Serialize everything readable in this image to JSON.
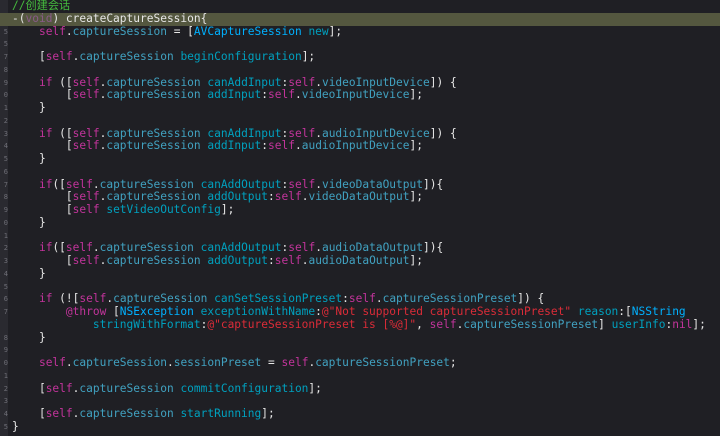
{
  "editor": {
    "lines": [
      {
        "num": "",
        "highlight": false,
        "tokens": [
          {
            "t": "//创建会话",
            "c": "comment"
          }
        ]
      },
      {
        "num": "",
        "highlight": true,
        "tokens": [
          {
            "t": "-(",
            "c": "plain"
          },
          {
            "t": "void",
            "c": "kw"
          },
          {
            "t": ") createCaptureSession{",
            "c": "plain"
          }
        ]
      },
      {
        "num": "5",
        "highlight": false,
        "tokens": [
          {
            "t": "    ",
            "c": "plain"
          },
          {
            "t": "self",
            "c": "kw"
          },
          {
            "t": ".",
            "c": "plain"
          },
          {
            "t": "captureSession",
            "c": "prop"
          },
          {
            "t": " = [",
            "c": "plain"
          },
          {
            "t": "AVCaptureSession",
            "c": "cls"
          },
          {
            "t": " ",
            "c": "plain"
          },
          {
            "t": "new",
            "c": "mth"
          },
          {
            "t": "];",
            "c": "plain"
          }
        ]
      },
      {
        "num": "5",
        "highlight": false,
        "tokens": []
      },
      {
        "num": "7",
        "highlight": false,
        "tokens": [
          {
            "t": "    [",
            "c": "plain"
          },
          {
            "t": "self",
            "c": "kw"
          },
          {
            "t": ".",
            "c": "plain"
          },
          {
            "t": "captureSession",
            "c": "prop"
          },
          {
            "t": " ",
            "c": "plain"
          },
          {
            "t": "beginConfiguration",
            "c": "mth"
          },
          {
            "t": "];",
            "c": "plain"
          }
        ]
      },
      {
        "num": "8",
        "highlight": false,
        "tokens": []
      },
      {
        "num": "9",
        "highlight": false,
        "tokens": [
          {
            "t": "    ",
            "c": "plain"
          },
          {
            "t": "if",
            "c": "kw"
          },
          {
            "t": " ([",
            "c": "plain"
          },
          {
            "t": "self",
            "c": "kw"
          },
          {
            "t": ".",
            "c": "plain"
          },
          {
            "t": "captureSession",
            "c": "prop"
          },
          {
            "t": " ",
            "c": "plain"
          },
          {
            "t": "canAddInput",
            "c": "mth"
          },
          {
            "t": ":",
            "c": "plain"
          },
          {
            "t": "self",
            "c": "kw"
          },
          {
            "t": ".",
            "c": "plain"
          },
          {
            "t": "videoInputDevice",
            "c": "prop"
          },
          {
            "t": "]) {",
            "c": "plain"
          }
        ]
      },
      {
        "num": "0",
        "highlight": false,
        "tokens": [
          {
            "t": "        [",
            "c": "plain"
          },
          {
            "t": "self",
            "c": "kw"
          },
          {
            "t": ".",
            "c": "plain"
          },
          {
            "t": "captureSession",
            "c": "prop"
          },
          {
            "t": " ",
            "c": "plain"
          },
          {
            "t": "addInput",
            "c": "mth"
          },
          {
            "t": ":",
            "c": "plain"
          },
          {
            "t": "self",
            "c": "kw"
          },
          {
            "t": ".",
            "c": "plain"
          },
          {
            "t": "videoInputDevice",
            "c": "prop"
          },
          {
            "t": "];",
            "c": "plain"
          }
        ]
      },
      {
        "num": "1",
        "highlight": false,
        "tokens": [
          {
            "t": "    }",
            "c": "plain"
          }
        ]
      },
      {
        "num": "2",
        "highlight": false,
        "tokens": []
      },
      {
        "num": "3",
        "highlight": false,
        "tokens": [
          {
            "t": "    ",
            "c": "plain"
          },
          {
            "t": "if",
            "c": "kw"
          },
          {
            "t": " ([",
            "c": "plain"
          },
          {
            "t": "self",
            "c": "kw"
          },
          {
            "t": ".",
            "c": "plain"
          },
          {
            "t": "captureSession",
            "c": "prop"
          },
          {
            "t": " ",
            "c": "plain"
          },
          {
            "t": "canAddInput",
            "c": "mth"
          },
          {
            "t": ":",
            "c": "plain"
          },
          {
            "t": "self",
            "c": "kw"
          },
          {
            "t": ".",
            "c": "plain"
          },
          {
            "t": "audioInputDevice",
            "c": "prop"
          },
          {
            "t": "]) {",
            "c": "plain"
          }
        ]
      },
      {
        "num": "4",
        "highlight": false,
        "tokens": [
          {
            "t": "        [",
            "c": "plain"
          },
          {
            "t": "self",
            "c": "kw"
          },
          {
            "t": ".",
            "c": "plain"
          },
          {
            "t": "captureSession",
            "c": "prop"
          },
          {
            "t": " ",
            "c": "plain"
          },
          {
            "t": "addInput",
            "c": "mth"
          },
          {
            "t": ":",
            "c": "plain"
          },
          {
            "t": "self",
            "c": "kw"
          },
          {
            "t": ".",
            "c": "plain"
          },
          {
            "t": "audioInputDevice",
            "c": "prop"
          },
          {
            "t": "];",
            "c": "plain"
          }
        ]
      },
      {
        "num": "5",
        "highlight": false,
        "tokens": [
          {
            "t": "    }",
            "c": "plain"
          }
        ]
      },
      {
        "num": "6",
        "highlight": false,
        "tokens": []
      },
      {
        "num": "7",
        "highlight": false,
        "tokens": [
          {
            "t": "    ",
            "c": "plain"
          },
          {
            "t": "if",
            "c": "kw"
          },
          {
            "t": "([",
            "c": "plain"
          },
          {
            "t": "self",
            "c": "kw"
          },
          {
            "t": ".",
            "c": "plain"
          },
          {
            "t": "captureSession",
            "c": "prop"
          },
          {
            "t": " ",
            "c": "plain"
          },
          {
            "t": "canAddOutput",
            "c": "mth"
          },
          {
            "t": ":",
            "c": "plain"
          },
          {
            "t": "self",
            "c": "kw"
          },
          {
            "t": ".",
            "c": "plain"
          },
          {
            "t": "videoDataOutput",
            "c": "prop"
          },
          {
            "t": "]){",
            "c": "plain"
          }
        ]
      },
      {
        "num": "8",
        "highlight": false,
        "tokens": [
          {
            "t": "        [",
            "c": "plain"
          },
          {
            "t": "self",
            "c": "kw"
          },
          {
            "t": ".",
            "c": "plain"
          },
          {
            "t": "captureSession",
            "c": "prop"
          },
          {
            "t": " ",
            "c": "plain"
          },
          {
            "t": "addOutput",
            "c": "mth"
          },
          {
            "t": ":",
            "c": "plain"
          },
          {
            "t": "self",
            "c": "kw"
          },
          {
            "t": ".",
            "c": "plain"
          },
          {
            "t": "videoDataOutput",
            "c": "prop"
          },
          {
            "t": "];",
            "c": "plain"
          }
        ]
      },
      {
        "num": "9",
        "highlight": false,
        "tokens": [
          {
            "t": "        [",
            "c": "plain"
          },
          {
            "t": "self",
            "c": "kw"
          },
          {
            "t": " ",
            "c": "plain"
          },
          {
            "t": "setVideoOutConfig",
            "c": "mth"
          },
          {
            "t": "];",
            "c": "plain"
          }
        ]
      },
      {
        "num": "0",
        "highlight": false,
        "tokens": [
          {
            "t": "    }",
            "c": "plain"
          }
        ]
      },
      {
        "num": "1",
        "highlight": false,
        "tokens": []
      },
      {
        "num": "2",
        "highlight": false,
        "tokens": [
          {
            "t": "    ",
            "c": "plain"
          },
          {
            "t": "if",
            "c": "kw"
          },
          {
            "t": "([",
            "c": "plain"
          },
          {
            "t": "self",
            "c": "kw"
          },
          {
            "t": ".",
            "c": "plain"
          },
          {
            "t": "captureSession",
            "c": "prop"
          },
          {
            "t": " ",
            "c": "plain"
          },
          {
            "t": "canAddOutput",
            "c": "mth"
          },
          {
            "t": ":",
            "c": "plain"
          },
          {
            "t": "self",
            "c": "kw"
          },
          {
            "t": ".",
            "c": "plain"
          },
          {
            "t": "audioDataOutput",
            "c": "prop"
          },
          {
            "t": "]){",
            "c": "plain"
          }
        ]
      },
      {
        "num": "3",
        "highlight": false,
        "tokens": [
          {
            "t": "        [",
            "c": "plain"
          },
          {
            "t": "self",
            "c": "kw"
          },
          {
            "t": ".",
            "c": "plain"
          },
          {
            "t": "captureSession",
            "c": "prop"
          },
          {
            "t": " ",
            "c": "plain"
          },
          {
            "t": "addOutput",
            "c": "mth"
          },
          {
            "t": ":",
            "c": "plain"
          },
          {
            "t": "self",
            "c": "kw"
          },
          {
            "t": ".",
            "c": "plain"
          },
          {
            "t": "audioDataOutput",
            "c": "prop"
          },
          {
            "t": "];",
            "c": "plain"
          }
        ]
      },
      {
        "num": "4",
        "highlight": false,
        "tokens": [
          {
            "t": "    }",
            "c": "plain"
          }
        ]
      },
      {
        "num": "5",
        "highlight": false,
        "tokens": []
      },
      {
        "num": "6",
        "highlight": false,
        "tokens": [
          {
            "t": "    ",
            "c": "plain"
          },
          {
            "t": "if",
            "c": "kw"
          },
          {
            "t": " (![",
            "c": "plain"
          },
          {
            "t": "self",
            "c": "kw"
          },
          {
            "t": ".",
            "c": "plain"
          },
          {
            "t": "captureSession",
            "c": "prop"
          },
          {
            "t": " ",
            "c": "plain"
          },
          {
            "t": "canSetSessionPreset",
            "c": "mth"
          },
          {
            "t": ":",
            "c": "plain"
          },
          {
            "t": "self",
            "c": "kw"
          },
          {
            "t": ".",
            "c": "plain"
          },
          {
            "t": "captureSessionPreset",
            "c": "prop"
          },
          {
            "t": "]) {",
            "c": "plain"
          }
        ]
      },
      {
        "num": "7",
        "highlight": false,
        "tokens": [
          {
            "t": "        ",
            "c": "plain"
          },
          {
            "t": "@throw",
            "c": "kw"
          },
          {
            "t": " [",
            "c": "plain"
          },
          {
            "t": "NSException",
            "c": "cls"
          },
          {
            "t": " ",
            "c": "plain"
          },
          {
            "t": "exceptionWithName",
            "c": "mth"
          },
          {
            "t": ":",
            "c": "plain"
          },
          {
            "t": "@\"Not supported captureSessionPreset\"",
            "c": "str"
          },
          {
            "t": " ",
            "c": "plain"
          },
          {
            "t": "reason",
            "c": "mth"
          },
          {
            "t": ":[",
            "c": "plain"
          },
          {
            "t": "NSString",
            "c": "cls"
          }
        ]
      },
      {
        "num": "",
        "highlight": false,
        "tokens": [
          {
            "t": "            ",
            "c": "plain"
          },
          {
            "t": "stringWithFormat",
            "c": "mth"
          },
          {
            "t": ":",
            "c": "plain"
          },
          {
            "t": "@\"captureSessionPreset is [%@]\"",
            "c": "str"
          },
          {
            "t": ", ",
            "c": "plain"
          },
          {
            "t": "self",
            "c": "kw"
          },
          {
            "t": ".",
            "c": "plain"
          },
          {
            "t": "captureSessionPreset",
            "c": "prop"
          },
          {
            "t": "] ",
            "c": "plain"
          },
          {
            "t": "userInfo",
            "c": "mth"
          },
          {
            "t": ":",
            "c": "plain"
          },
          {
            "t": "nil",
            "c": "kw"
          },
          {
            "t": "];",
            "c": "plain"
          }
        ]
      },
      {
        "num": "8",
        "highlight": false,
        "tokens": [
          {
            "t": "    }",
            "c": "plain"
          }
        ]
      },
      {
        "num": "9",
        "highlight": false,
        "tokens": []
      },
      {
        "num": "0",
        "highlight": false,
        "tokens": [
          {
            "t": "    ",
            "c": "plain"
          },
          {
            "t": "self",
            "c": "kw"
          },
          {
            "t": ".",
            "c": "plain"
          },
          {
            "t": "captureSession",
            "c": "prop"
          },
          {
            "t": ".",
            "c": "plain"
          },
          {
            "t": "sessionPreset",
            "c": "prop"
          },
          {
            "t": " = ",
            "c": "plain"
          },
          {
            "t": "self",
            "c": "kw"
          },
          {
            "t": ".",
            "c": "plain"
          },
          {
            "t": "captureSessionPreset",
            "c": "prop"
          },
          {
            "t": ";",
            "c": "plain"
          }
        ]
      },
      {
        "num": "1",
        "highlight": false,
        "tokens": []
      },
      {
        "num": "2",
        "highlight": false,
        "tokens": [
          {
            "t": "    [",
            "c": "plain"
          },
          {
            "t": "self",
            "c": "kw"
          },
          {
            "t": ".",
            "c": "plain"
          },
          {
            "t": "captureSession",
            "c": "prop"
          },
          {
            "t": " ",
            "c": "plain"
          },
          {
            "t": "commitConfiguration",
            "c": "mth"
          },
          {
            "t": "];",
            "c": "plain"
          }
        ]
      },
      {
        "num": "3",
        "highlight": false,
        "tokens": []
      },
      {
        "num": "4",
        "highlight": false,
        "tokens": [
          {
            "t": "    [",
            "c": "plain"
          },
          {
            "t": "self",
            "c": "kw"
          },
          {
            "t": ".",
            "c": "plain"
          },
          {
            "t": "captureSession",
            "c": "prop"
          },
          {
            "t": " ",
            "c": "plain"
          },
          {
            "t": "startRunning",
            "c": "mth"
          },
          {
            "t": "];",
            "c": "plain"
          }
        ]
      },
      {
        "num": "5",
        "highlight": false,
        "tokens": [
          {
            "t": "}",
            "c": "plain"
          }
        ]
      }
    ]
  },
  "colors": {
    "background": "#1f1f24",
    "highlight_line": "#54573f",
    "comment": "#45bb3e",
    "keyword": "#c2349b",
    "class": "#00b1ff",
    "method": "#00a0be",
    "property": "#41a1c0",
    "string": "#db2c38",
    "plain": "#e6e6e6"
  }
}
